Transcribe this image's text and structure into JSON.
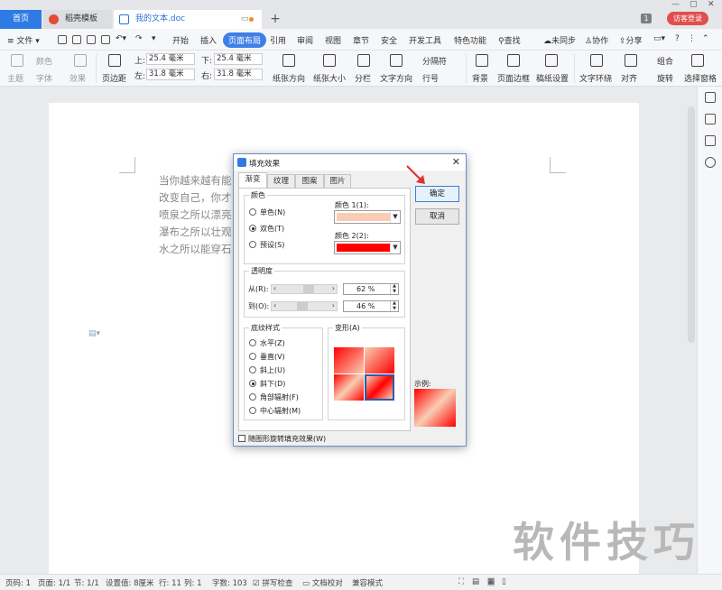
{
  "tabbar": {
    "home": "首页",
    "tabs": [
      {
        "label": "稻壳模板"
      },
      {
        "label": "我的文本.doc"
      }
    ],
    "add": "+",
    "badge": "1",
    "login": "访客登录"
  },
  "menubar": {
    "file": "文件",
    "items": [
      "开始",
      "插入",
      "页面布局",
      "引用",
      "审阅",
      "视图",
      "章节",
      "安全",
      "开发工具",
      "特色功能"
    ],
    "active": "页面布局",
    "search": "查找",
    "sync": "未同步",
    "collab": "协作",
    "share": "分享"
  },
  "ribbon": {
    "theme": "主题",
    "color": "颜色",
    "font": "字体",
    "effect": "效果",
    "margins": "页边距",
    "top_label": "上:",
    "top_value": "25.4 毫米",
    "bottom_label": "下:",
    "bottom_value": "25.4 毫米",
    "left_label": "左:",
    "left_value": "31.8 毫米",
    "right_label": "右:",
    "right_value": "31.8 毫米",
    "orientation": "纸张方向",
    "size": "纸张大小",
    "columns": "分栏",
    "text_dir": "文字方向",
    "breaks": "分隔符",
    "line_no": "行号",
    "background": "背景",
    "border": "页面边框",
    "paper_setting": "稿纸设置",
    "wrap": "文字环绕",
    "align": "对齐",
    "rotate": "旋转",
    "group": "组合",
    "select_pane": "选择窗格"
  },
  "document": {
    "lines": [
      "当你越来越有能",
      "改变自己，你才",
      "喷泉之所以漂亮",
      "瀑布之所以壮观",
      "水之所以能穿石"
    ]
  },
  "watermark": "软件技巧",
  "dialog": {
    "title": "填充效果",
    "close": "✕",
    "tabs": [
      "渐变",
      "纹理",
      "图案",
      "图片"
    ],
    "colors_group": "颜色",
    "options": {
      "single": "单色(N)",
      "dual": "双色(T)",
      "preset": "预设(S)"
    },
    "color1_label": "颜色 1(1):",
    "color2_label": "颜色 2(2):",
    "color1": "#f9cdb3",
    "color2": "#ff0000",
    "transparency_group": "透明度",
    "from_label": "从(R):",
    "from_value": "62 %",
    "from_fraction": 0.62,
    "to_label": "到(O):",
    "to_value": "46 %",
    "to_fraction": 0.46,
    "shading_group": "底纹样式",
    "shading": [
      "水平(Z)",
      "垂直(V)",
      "斜上(U)",
      "斜下(D)",
      "角部辐射(F)",
      "中心辐射(M)"
    ],
    "shading_selected": "斜下(D)",
    "variants_group": "变形(A)",
    "ok": "确定",
    "cancel": "取消",
    "sample_label": "示例:",
    "rotate_checkbox": "随图形旋转填充效果(W)"
  },
  "statusbar": {
    "page_no": "页码: 1",
    "pages": "页面: 1/1",
    "section": "节: 1/1",
    "setting": "设置值: 8厘米",
    "row": "行: 11",
    "col": "列: 1",
    "words": "字数: 103",
    "spell": "拼写检查",
    "proof": "文档校对",
    "compat": "兼容模式"
  }
}
